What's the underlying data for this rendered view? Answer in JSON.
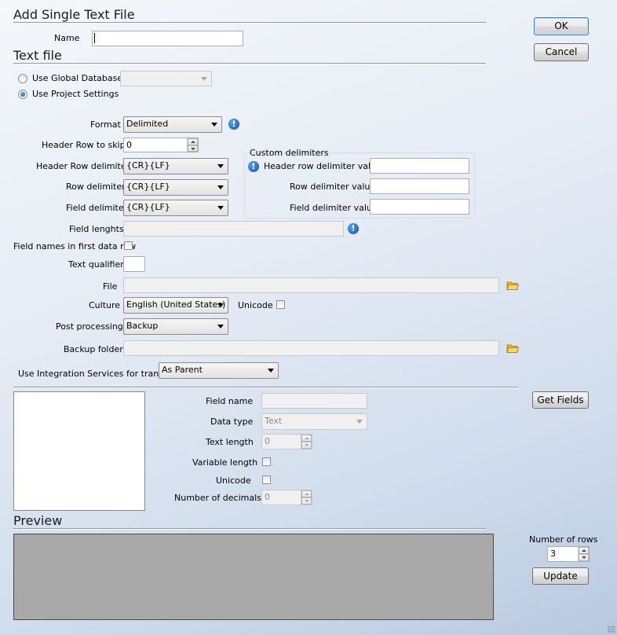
{
  "dialog": {
    "title": "Add Single Text File",
    "ok_label": "OK",
    "cancel_label": "Cancel"
  },
  "name_field": {
    "label": "Name",
    "value": ""
  },
  "text_file": {
    "section_title": "Text file",
    "use_global_label": "Use Global Database",
    "global_db_value": "",
    "use_project_label": "Use Project Settings",
    "selected_source": "Use Project Settings",
    "format_label": "Format",
    "format_value": "Delimited",
    "header_skip_label": "Header Row to skip",
    "header_skip_value": "0",
    "header_row_delim_label": "Header Row delimiter",
    "header_row_delim_value": "{CR}{LF}",
    "row_delim_label": "Row delimiter",
    "row_delim_value": "{CR}{LF}",
    "field_delim_label": "Field delimiter",
    "field_delim_value": "{CR}{LF}",
    "custom_delims": {
      "legend": "Custom delimiters",
      "header_row_label": "Header row delimiter value",
      "header_row_value": "",
      "row_label": "Row delimiter value",
      "row_value": "",
      "field_label": "Field delimiter value",
      "field_value": ""
    },
    "field_lengths_label": "Field lenghts",
    "field_lengths_value": "",
    "field_names_label": "Field names in first data row",
    "field_names_checked": false,
    "text_qualifier_label": "Text qualifier",
    "text_qualifier_value": "",
    "file_label": "File",
    "file_value": "",
    "culture_label": "Culture",
    "culture_value": "English (United States)",
    "unicode_label": "Unicode",
    "unicode_checked": false,
    "post_processing_label": "Post processing",
    "post_processing_value": "Backup",
    "backup_folder_label": "Backup folder",
    "backup_folder_value": "",
    "integration_label": "Use Integration Services for transfer",
    "integration_value": "As Parent"
  },
  "fields": {
    "get_fields_label": "Get Fields",
    "field_name_label": "Field name",
    "field_name_value": "",
    "data_type_label": "Data type",
    "data_type_value": "Text",
    "text_length_label": "Text length",
    "text_length_value": "0",
    "variable_length_label": "Variable length",
    "unicode_label": "Unicode",
    "decimals_label": "Number of decimals",
    "decimals_value": "0"
  },
  "preview": {
    "section_title": "Preview",
    "rows_label": "Number of rows",
    "rows_value": "3",
    "update_label": "Update"
  },
  "icons": {
    "info": "info-icon",
    "folder": "folder-icon"
  },
  "colors": {
    "info_blue": "#0b4fb3",
    "preview_gray": "#a9a9a9",
    "folder_yellow": "#f2c94c"
  }
}
